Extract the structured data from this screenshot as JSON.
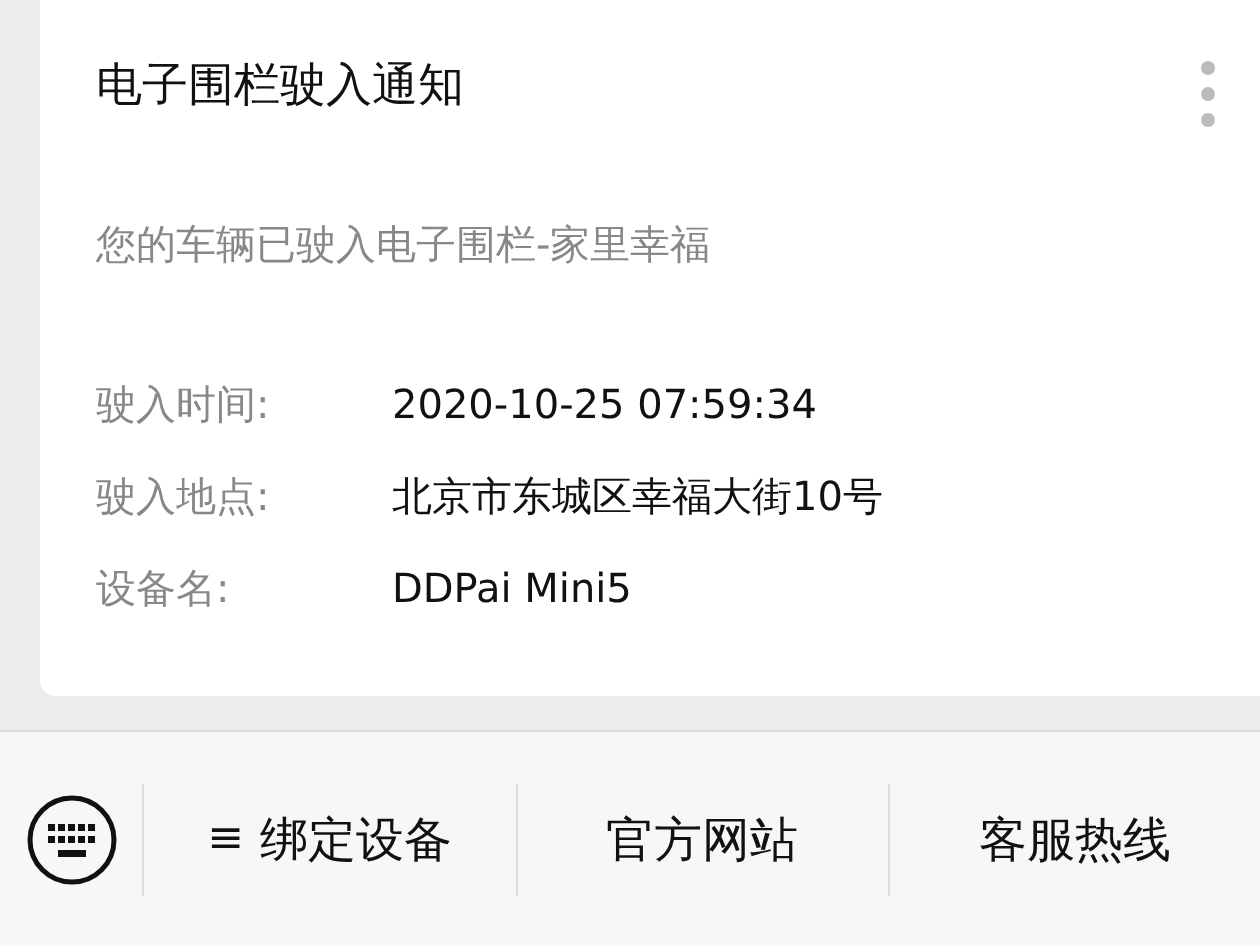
{
  "card": {
    "title": "电子围栏驶入通知",
    "message": "您的车辆已驶入电子围栏-家里幸福",
    "fields": [
      {
        "label": "驶入时间:",
        "value": "2020-10-25 07:59:34"
      },
      {
        "label": "驶入地点:",
        "value": "北京市东城区幸福大街10号"
      },
      {
        "label": "设备名:",
        "value": "DDPai Mini5"
      }
    ]
  },
  "menu": [
    {
      "prefix": "≡",
      "label": "绑定设备"
    },
    {
      "label": "官方网站"
    },
    {
      "label": "客服热线"
    }
  ]
}
